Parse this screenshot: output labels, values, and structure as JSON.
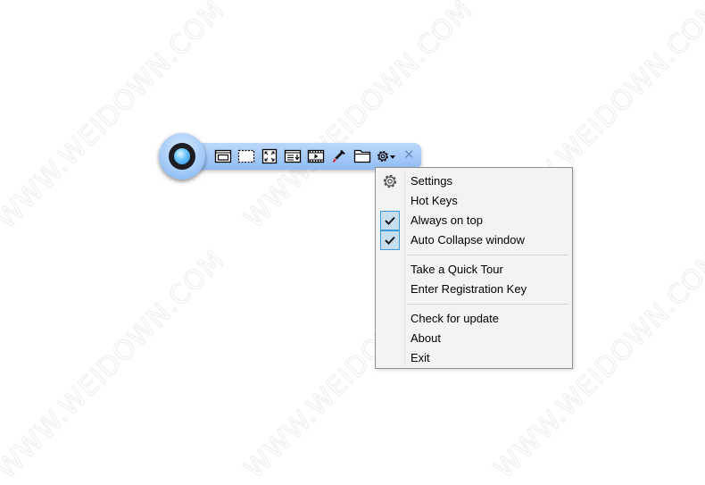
{
  "watermark": "WWW.WEIDOWN.COM",
  "toolbar": {
    "buttons": [
      {
        "name": "capture-window",
        "icon": "window-icon",
        "title": "Capture window"
      },
      {
        "name": "capture-region",
        "icon": "dashed-rect-icon",
        "title": "Capture region"
      },
      {
        "name": "capture-fullscreen",
        "icon": "fullscreen-icon",
        "title": "Capture full screen"
      },
      {
        "name": "capture-scrolling",
        "icon": "scroll-window-icon",
        "title": "Capture scrolling window"
      },
      {
        "name": "record-video",
        "icon": "film-icon",
        "title": "Record video"
      },
      {
        "name": "color-picker",
        "icon": "eyedropper-icon",
        "title": "Color picker"
      },
      {
        "name": "open-folder",
        "icon": "folder-icon",
        "title": "Open folder"
      },
      {
        "name": "settings-menu",
        "icon": "gear-dropdown-icon",
        "title": "Settings menu"
      }
    ],
    "close_glyph": "✕"
  },
  "menu": {
    "items": [
      {
        "label": "Settings",
        "icon": "gear-icon",
        "checked": false
      },
      {
        "label": "Hot Keys",
        "checked": false
      },
      {
        "label": "Always on top",
        "checked": true
      },
      {
        "label": "Auto Collapse window",
        "checked": true
      },
      {
        "label": "Take a Quick Tour",
        "checked": false
      },
      {
        "label": "Enter Registration Key",
        "checked": false
      },
      {
        "label": "Check for update",
        "checked": false
      },
      {
        "label": "About",
        "checked": false
      },
      {
        "label": "Exit",
        "checked": false
      }
    ]
  },
  "colors": {
    "toolbar_blue": "#a5cbf8",
    "menu_bg": "#f3f3f3",
    "check_bg": "#c5dff0",
    "check_border": "#3d9ad6"
  }
}
